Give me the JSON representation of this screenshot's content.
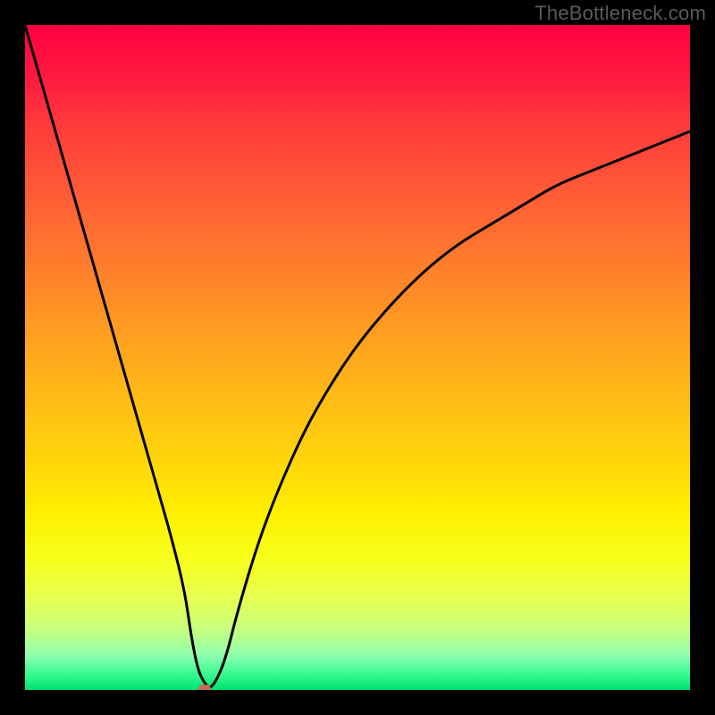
{
  "watermark": "TheBottleneck.com",
  "chart_data": {
    "type": "line",
    "title": "",
    "xlabel": "",
    "ylabel": "",
    "ylim": [
      0,
      100
    ],
    "x": [
      0,
      2,
      4,
      6,
      8,
      10,
      12,
      14,
      16,
      18,
      20,
      22,
      24,
      25,
      26,
      27,
      28,
      30,
      32,
      35,
      38,
      42,
      46,
      50,
      55,
      60,
      65,
      70,
      75,
      80,
      85,
      90,
      95,
      100
    ],
    "values": [
      100,
      93,
      86,
      79,
      72,
      65,
      58,
      51,
      44,
      37,
      30,
      23,
      15,
      8,
      3,
      1,
      0,
      4,
      12,
      22,
      30,
      39,
      46,
      52,
      58,
      63,
      67,
      70,
      73,
      76,
      78,
      80,
      82,
      84
    ],
    "marker": {
      "x": 27,
      "y": 0
    },
    "gradient_stops": [
      {
        "pos": 0,
        "color": "#ff0040"
      },
      {
        "pos": 50,
        "color": "#ffb000"
      },
      {
        "pos": 75,
        "color": "#ffff00"
      },
      {
        "pos": 100,
        "color": "#00e070"
      }
    ]
  }
}
